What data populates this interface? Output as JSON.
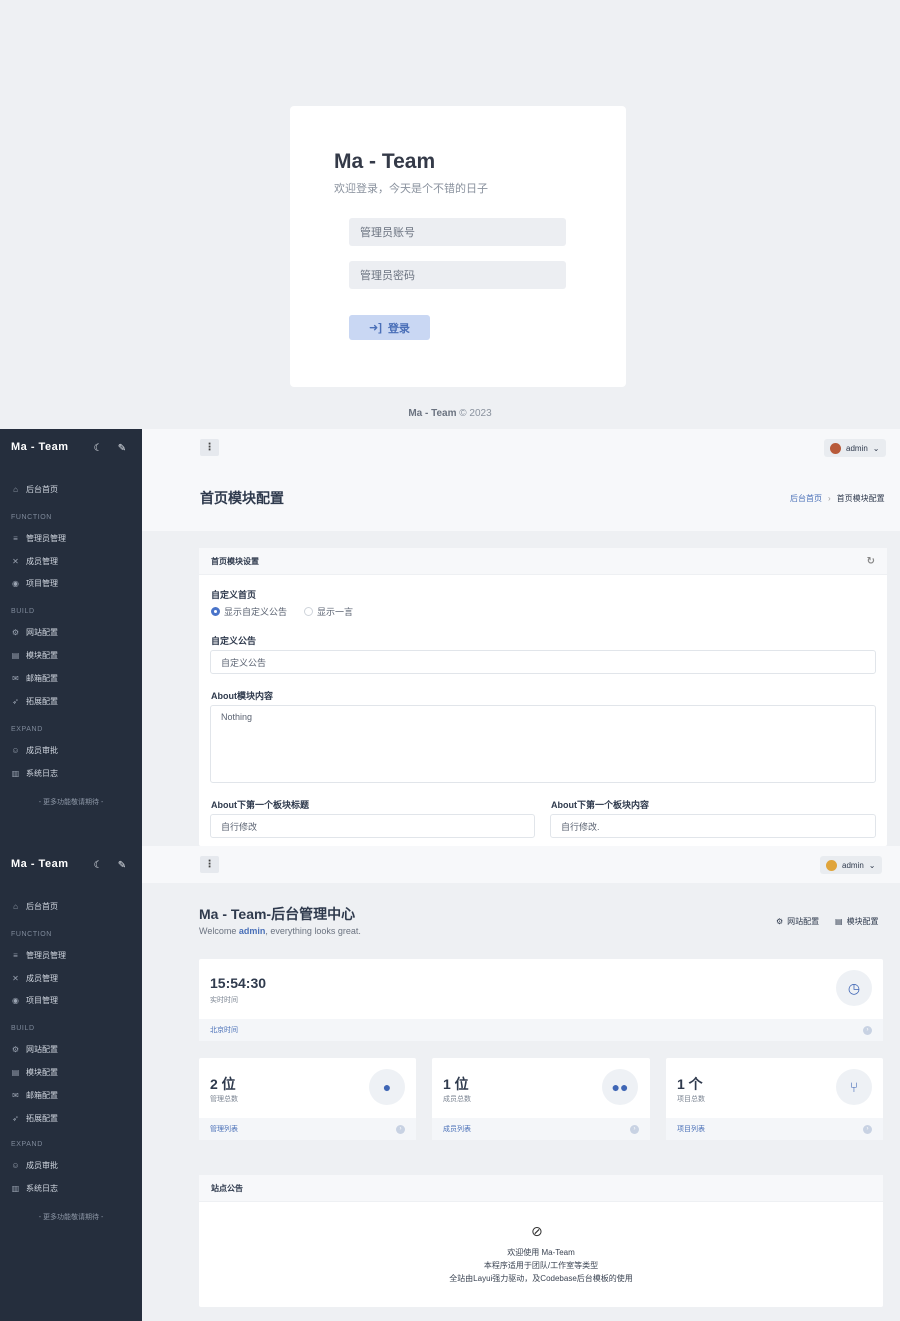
{
  "login": {
    "title": "Ma - Team",
    "subtitle": "欢迎登录，今天是个不错的日子",
    "username_placeholder": "管理员账号",
    "password_placeholder": "管理员密码",
    "login_button": "登录",
    "footer_brand": "Ma - Team",
    "footer_copy": "© 2023"
  },
  "sidebar": {
    "brand": "Ma - Team",
    "home": "后台首页",
    "section_function": "FUNCTION",
    "admin_mgmt": "管理员管理",
    "member_mgmt": "成员管理",
    "project_mgmt": "项目管理",
    "section_build": "BUILD",
    "site_config": "网站配置",
    "module_config": "模块配置",
    "mail_config": "邮箱配置",
    "ext_config": "拓展配置",
    "section_expand": "EXPAND",
    "member_review": "成员审批",
    "system_log": "系统日志",
    "more": "- 更多功能敬请期待 -"
  },
  "topbar": {
    "user": "admin"
  },
  "module_page": {
    "title": "首页模块配置",
    "breadcrumb_home": "后台首页",
    "breadcrumb_current": "首页模块配置",
    "block_title": "首页模块设置",
    "custom_home_label": "自定义首页",
    "radio_custom_notice": "显示自定义公告",
    "radio_hitokoto": "显示一言",
    "custom_notice_label": "自定义公告",
    "custom_notice_value": "自定义公告",
    "about_label": "About模块内容",
    "about_value": "Nothing",
    "first_title_label": "About下第一个板块标题",
    "first_title_value": "自行修改",
    "first_content_label": "About下第一个板块内容",
    "first_content_value": "自行修改."
  },
  "dashboard": {
    "title": "Ma - Team-后台管理中心",
    "welcome_prefix": "Welcome ",
    "welcome_user": "admin",
    "welcome_suffix": ", everything looks great.",
    "quick_site": "网站配置",
    "quick_module": "模块配置",
    "clock_value": "15:54:30",
    "clock_label": "实时时间",
    "clock_footer": "北京时间",
    "stats": [
      {
        "value": "2 位",
        "label": "管理总数",
        "footer": "管理列表"
      },
      {
        "value": "1 位",
        "label": "成员总数",
        "footer": "成员列表"
      },
      {
        "value": "1 个",
        "label": "项目总数",
        "footer": "项目列表"
      }
    ],
    "notice_title": "站点公告",
    "notice_line1": "欢迎使用 Ma-Team",
    "notice_line2": "本程序适用于团队/工作室等类型",
    "notice_line3": "全站由Layui强力驱动，及Codebase后台模板的使用"
  },
  "colors": {
    "sidebar_bg": "#252e3d",
    "accent": "#4a74c9",
    "page_bg": "#eef0f3"
  }
}
